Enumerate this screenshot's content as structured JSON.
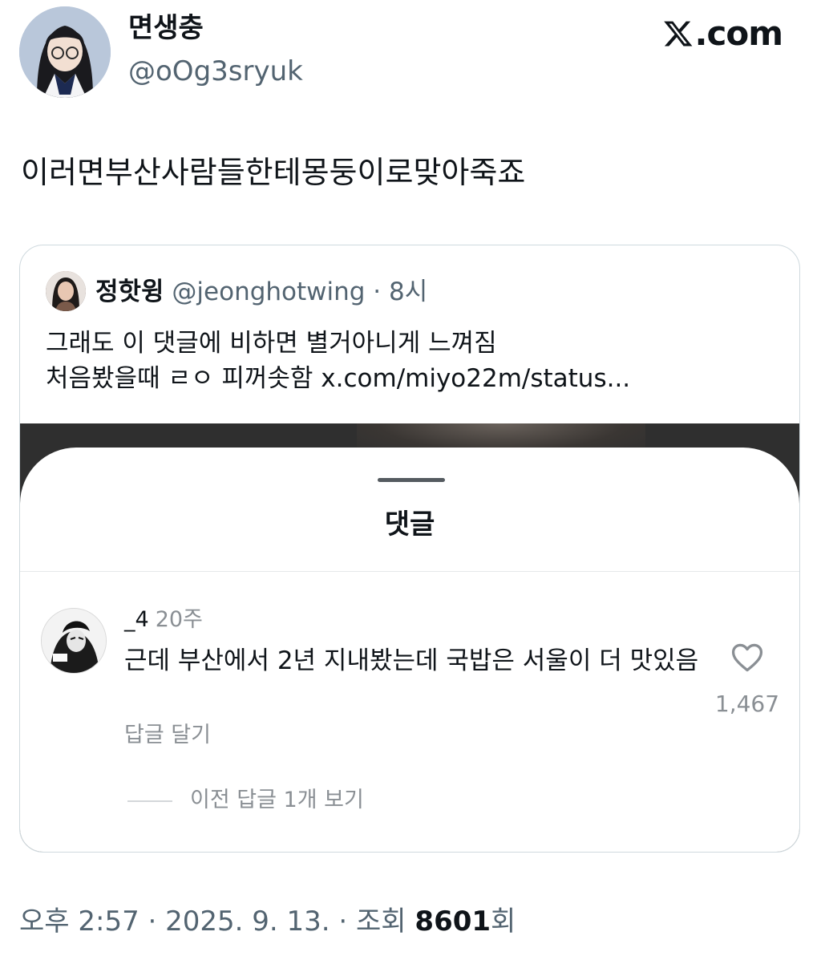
{
  "author": {
    "display_name": "면생충",
    "handle": "@oOg3sryuk"
  },
  "brand": {
    "logo_text": ".com",
    "logo_icon": "x-logo-icon"
  },
  "tweet": {
    "text": "이러면부산사람들한테몽둥이로맞아죽죠"
  },
  "quoted_tweet": {
    "display_name": "정핫윙",
    "handle_meta": " @jeonghotwing · 8시",
    "lines": [
      "그래도 이 댓글에 비하면 별거아니게 느껴짐",
      "처음봤을때 ㄹㅇ 피꺼솟함 x.com/miyo22m/status..."
    ],
    "comment_sheet": {
      "title": "댓글",
      "comment": {
        "username": "_4",
        "time": "20주",
        "text": "근데 부산에서 2년 지내봤는데 국밥은 서울이 더 맛있음",
        "reply_label": "답글 달기",
        "likes": "1,467",
        "view_replies": "이전 답글 1개 보기"
      }
    }
  },
  "footer": {
    "prefix": "오후 2:57 · 2025. 9. 13. · 조회 ",
    "views": "8601",
    "suffix": "회"
  },
  "colors": {
    "text_primary": "#0f1419",
    "text_secondary": "#536471",
    "border": "#cfd9de"
  }
}
